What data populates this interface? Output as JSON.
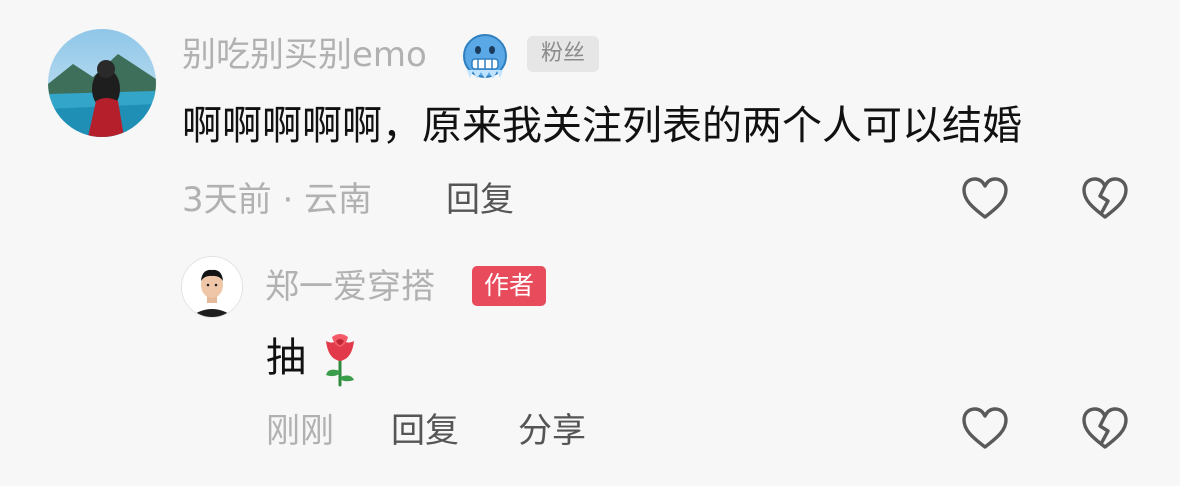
{
  "comment": {
    "username": "别吃别买别emo",
    "username_emoji": "cold-face-emoji",
    "fan_badge": "粉丝",
    "text": "啊啊啊啊啊，原来我关注列表的两个人可以结婚",
    "meta": "3天前 · 云南",
    "reply_label": "回复"
  },
  "reply": {
    "username": "郑一爱穿搭",
    "author_badge": "作者",
    "text": "抽",
    "text_emoji": "rose-emoji",
    "meta": "刚刚",
    "reply_label": "回复",
    "share_label": "分享"
  },
  "icons": {
    "like": "heart-outline-icon",
    "dislike": "broken-heart-icon"
  },
  "colors": {
    "background": "#f7f7f7",
    "author_badge": "#e84b5b",
    "secondary_text": "#b1b1b1"
  }
}
